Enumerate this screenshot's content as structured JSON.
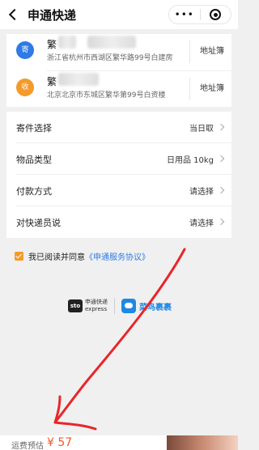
{
  "header": {
    "title": "申通快递",
    "more_label": "•••"
  },
  "sender": {
    "badge": "寄",
    "name": "繁",
    "address": "浙江省杭州市西湖区繁华路99号白建房",
    "book_label": "地址簿"
  },
  "receiver": {
    "badge": "收",
    "name": "繁",
    "address": "北京北京市东城区繁华第99号白资楼",
    "book_label": "地址簿"
  },
  "options": [
    {
      "label": "寄件选择",
      "value": "当日取"
    },
    {
      "label": "物品类型",
      "value": "日用品 10kg"
    },
    {
      "label": "付款方式",
      "value": "请选择"
    },
    {
      "label": "对快递员说",
      "value": "请选择"
    }
  ],
  "agreement": {
    "text": "我已阅读并同意",
    "link": "《申通服务协议》"
  },
  "logos": {
    "sto_mark": "sto",
    "sto_cn": "申通快递",
    "sto_en": "express",
    "cainiao": "菜鸟裹裹"
  },
  "bottom": {
    "fee_label": "运费预估",
    "fee_value": "¥ 57"
  },
  "colors": {
    "accent_blue": "#2f7be5",
    "accent_orange": "#f39a2b",
    "price_orange": "#f05a28",
    "annotation_red": "#e8262a"
  }
}
